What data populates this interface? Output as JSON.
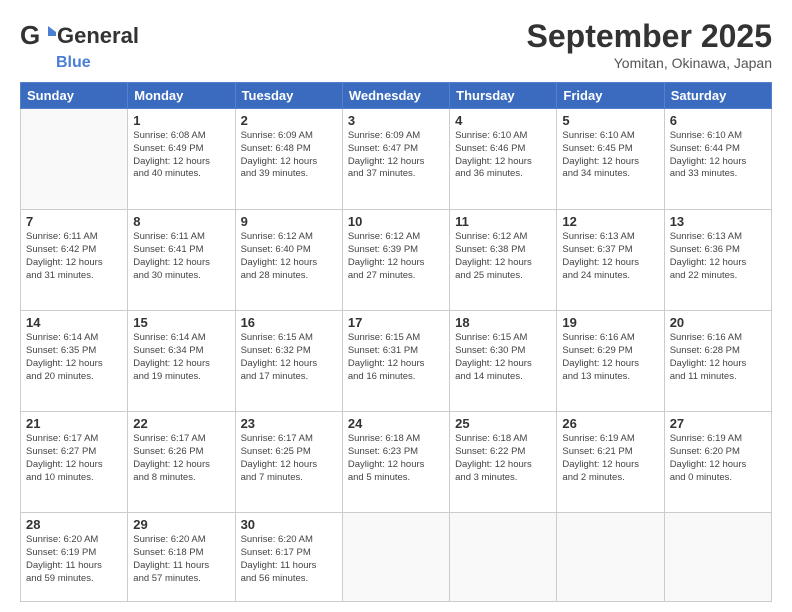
{
  "logo": {
    "line1": "General",
    "line2": "Blue",
    "icon_color": "#4a90d9"
  },
  "header": {
    "month": "September 2025",
    "location": "Yomitan, Okinawa, Japan"
  },
  "weekdays": [
    "Sunday",
    "Monday",
    "Tuesday",
    "Wednesday",
    "Thursday",
    "Friday",
    "Saturday"
  ],
  "weeks": [
    [
      {
        "day": "",
        "info": ""
      },
      {
        "day": "1",
        "info": "Sunrise: 6:08 AM\nSunset: 6:49 PM\nDaylight: 12 hours\nand 40 minutes."
      },
      {
        "day": "2",
        "info": "Sunrise: 6:09 AM\nSunset: 6:48 PM\nDaylight: 12 hours\nand 39 minutes."
      },
      {
        "day": "3",
        "info": "Sunrise: 6:09 AM\nSunset: 6:47 PM\nDaylight: 12 hours\nand 37 minutes."
      },
      {
        "day": "4",
        "info": "Sunrise: 6:10 AM\nSunset: 6:46 PM\nDaylight: 12 hours\nand 36 minutes."
      },
      {
        "day": "5",
        "info": "Sunrise: 6:10 AM\nSunset: 6:45 PM\nDaylight: 12 hours\nand 34 minutes."
      },
      {
        "day": "6",
        "info": "Sunrise: 6:10 AM\nSunset: 6:44 PM\nDaylight: 12 hours\nand 33 minutes."
      }
    ],
    [
      {
        "day": "7",
        "info": "Sunrise: 6:11 AM\nSunset: 6:42 PM\nDaylight: 12 hours\nand 31 minutes."
      },
      {
        "day": "8",
        "info": "Sunrise: 6:11 AM\nSunset: 6:41 PM\nDaylight: 12 hours\nand 30 minutes."
      },
      {
        "day": "9",
        "info": "Sunrise: 6:12 AM\nSunset: 6:40 PM\nDaylight: 12 hours\nand 28 minutes."
      },
      {
        "day": "10",
        "info": "Sunrise: 6:12 AM\nSunset: 6:39 PM\nDaylight: 12 hours\nand 27 minutes."
      },
      {
        "day": "11",
        "info": "Sunrise: 6:12 AM\nSunset: 6:38 PM\nDaylight: 12 hours\nand 25 minutes."
      },
      {
        "day": "12",
        "info": "Sunrise: 6:13 AM\nSunset: 6:37 PM\nDaylight: 12 hours\nand 24 minutes."
      },
      {
        "day": "13",
        "info": "Sunrise: 6:13 AM\nSunset: 6:36 PM\nDaylight: 12 hours\nand 22 minutes."
      }
    ],
    [
      {
        "day": "14",
        "info": "Sunrise: 6:14 AM\nSunset: 6:35 PM\nDaylight: 12 hours\nand 20 minutes."
      },
      {
        "day": "15",
        "info": "Sunrise: 6:14 AM\nSunset: 6:34 PM\nDaylight: 12 hours\nand 19 minutes."
      },
      {
        "day": "16",
        "info": "Sunrise: 6:15 AM\nSunset: 6:32 PM\nDaylight: 12 hours\nand 17 minutes."
      },
      {
        "day": "17",
        "info": "Sunrise: 6:15 AM\nSunset: 6:31 PM\nDaylight: 12 hours\nand 16 minutes."
      },
      {
        "day": "18",
        "info": "Sunrise: 6:15 AM\nSunset: 6:30 PM\nDaylight: 12 hours\nand 14 minutes."
      },
      {
        "day": "19",
        "info": "Sunrise: 6:16 AM\nSunset: 6:29 PM\nDaylight: 12 hours\nand 13 minutes."
      },
      {
        "day": "20",
        "info": "Sunrise: 6:16 AM\nSunset: 6:28 PM\nDaylight: 12 hours\nand 11 minutes."
      }
    ],
    [
      {
        "day": "21",
        "info": "Sunrise: 6:17 AM\nSunset: 6:27 PM\nDaylight: 12 hours\nand 10 minutes."
      },
      {
        "day": "22",
        "info": "Sunrise: 6:17 AM\nSunset: 6:26 PM\nDaylight: 12 hours\nand 8 minutes."
      },
      {
        "day": "23",
        "info": "Sunrise: 6:17 AM\nSunset: 6:25 PM\nDaylight: 12 hours\nand 7 minutes."
      },
      {
        "day": "24",
        "info": "Sunrise: 6:18 AM\nSunset: 6:23 PM\nDaylight: 12 hours\nand 5 minutes."
      },
      {
        "day": "25",
        "info": "Sunrise: 6:18 AM\nSunset: 6:22 PM\nDaylight: 12 hours\nand 3 minutes."
      },
      {
        "day": "26",
        "info": "Sunrise: 6:19 AM\nSunset: 6:21 PM\nDaylight: 12 hours\nand 2 minutes."
      },
      {
        "day": "27",
        "info": "Sunrise: 6:19 AM\nSunset: 6:20 PM\nDaylight: 12 hours\nand 0 minutes."
      }
    ],
    [
      {
        "day": "28",
        "info": "Sunrise: 6:20 AM\nSunset: 6:19 PM\nDaylight: 11 hours\nand 59 minutes."
      },
      {
        "day": "29",
        "info": "Sunrise: 6:20 AM\nSunset: 6:18 PM\nDaylight: 11 hours\nand 57 minutes."
      },
      {
        "day": "30",
        "info": "Sunrise: 6:20 AM\nSunset: 6:17 PM\nDaylight: 11 hours\nand 56 minutes."
      },
      {
        "day": "",
        "info": ""
      },
      {
        "day": "",
        "info": ""
      },
      {
        "day": "",
        "info": ""
      },
      {
        "day": "",
        "info": ""
      }
    ]
  ]
}
